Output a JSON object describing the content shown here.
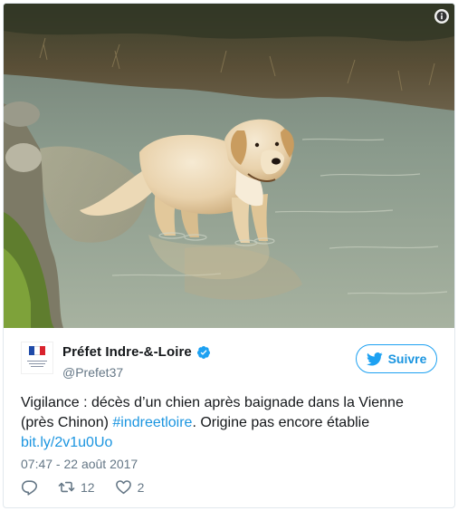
{
  "photo": {
    "alt_subject": "golden retriever standing in a shallow river"
  },
  "account": {
    "display_name": "Préfet Indre-&-Loire",
    "handle": "@Prefet37",
    "verified": true
  },
  "follow_button": {
    "label": "Suivre"
  },
  "tweet": {
    "text_before": "Vigilance : décès d’un chien après baignade dans la Vienne (près Chinon) ",
    "hashtag": "#indreetloire",
    "text_after": ". Origine pas encore établie ",
    "link": "bit.ly/2v1u0Uo",
    "timestamp": "07:47 - 22 août 2017"
  },
  "actions": {
    "reply_icon": "reply-icon",
    "retweet_icon": "retweet-icon",
    "retweet_count": "12",
    "like_icon": "heart-icon",
    "like_count": "2"
  },
  "colors": {
    "brand_blue": "#1da1f2",
    "link_blue": "#1b95e0",
    "secondary_text": "#657786",
    "primary_text": "#14171a"
  }
}
